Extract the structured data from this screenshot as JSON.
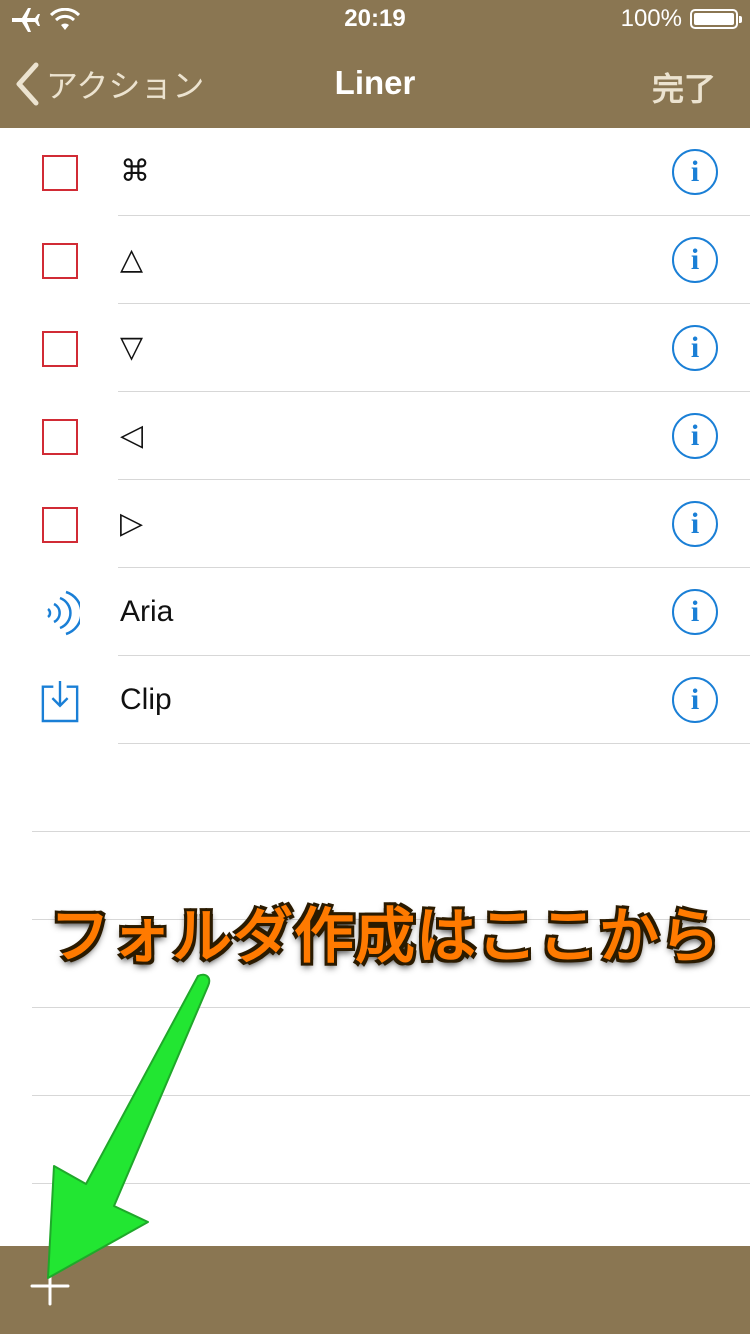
{
  "status_bar": {
    "time": "20:19",
    "battery": "100%"
  },
  "nav": {
    "back_label": "アクション",
    "title": "Liner",
    "done_label": "完了"
  },
  "rows": [
    {
      "icon": "checkbox",
      "label": "⌘"
    },
    {
      "icon": "checkbox",
      "label": "△"
    },
    {
      "icon": "checkbox",
      "label": "▽"
    },
    {
      "icon": "checkbox",
      "label": "◁"
    },
    {
      "icon": "checkbox",
      "label": "▷"
    },
    {
      "icon": "sound-wave-icon",
      "label": "Aria"
    },
    {
      "icon": "download-tray-icon",
      "label": "Clip"
    }
  ],
  "info_glyph": "i",
  "annotation": {
    "text": "フォルダ作成はここから"
  },
  "colors": {
    "bar": "#8a7652",
    "accent": "#1a7fd6",
    "checkbox": "#d12b35",
    "arrow": "#22e632",
    "annotation": "#ff7a00"
  }
}
